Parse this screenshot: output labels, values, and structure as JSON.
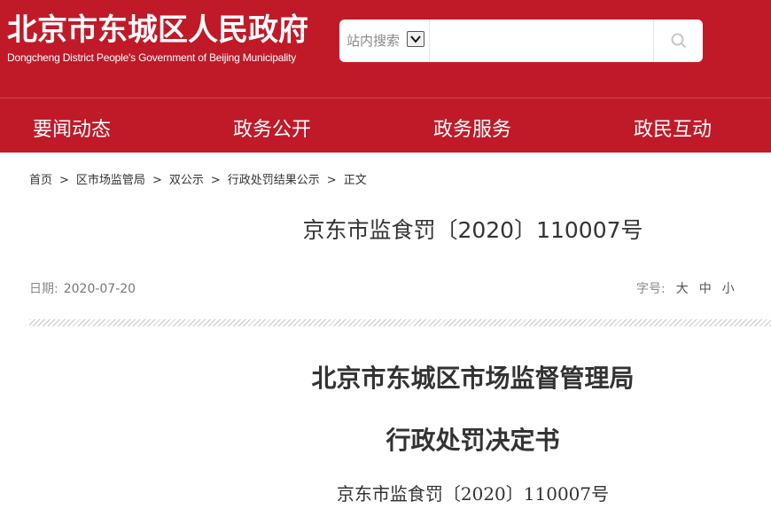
{
  "header": {
    "title": "北京市东城区人民政府",
    "subtitle": "Dongcheng District People's Government of Beijing Municipality",
    "background_color": "#c01a29"
  },
  "search": {
    "scope_label": "站内搜索",
    "scope_icon": "chevron-down-icon",
    "value": "",
    "button_icon": "search-icon"
  },
  "nav": {
    "items": [
      {
        "label": "要闻动态"
      },
      {
        "label": "政务公开"
      },
      {
        "label": "政务服务"
      },
      {
        "label": "政民互动"
      }
    ]
  },
  "breadcrumb": {
    "items": [
      {
        "label": "首页"
      },
      {
        "label": "区市场监管局"
      },
      {
        "label": "双公示"
      },
      {
        "label": "行政处罚结果公示"
      },
      {
        "label": "正文"
      }
    ],
    "separator": ">"
  },
  "article": {
    "title": "京东市监食罚〔2020〕110007号",
    "date_label": "日期:",
    "date_value": "2020-07-20",
    "font_size_label": "字号:",
    "font_size_options": [
      "大",
      "中",
      "小"
    ]
  },
  "body": {
    "heading1": "北京市东城区市场监督管理局",
    "heading2": "行政处罚决定书",
    "doc_number": "京东市监食罚〔2020〕110007号"
  }
}
